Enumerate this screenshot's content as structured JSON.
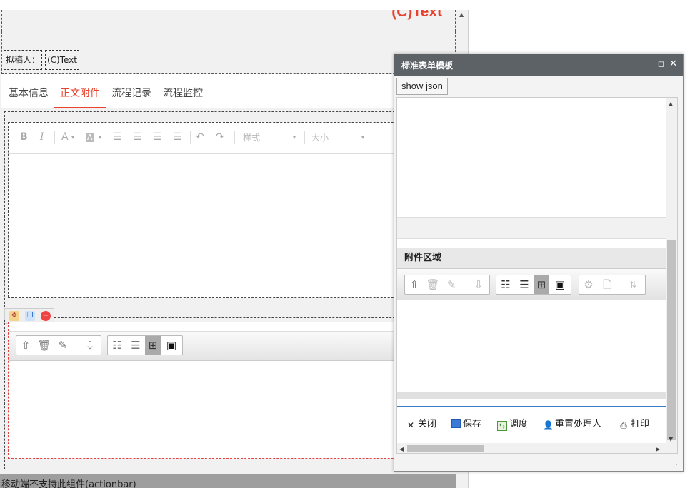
{
  "designer": {
    "title": "(C)Text",
    "drafter_label": "拟稿人：",
    "drafter_value": "(C)Text",
    "tabs": [
      {
        "label": "基本信息"
      },
      {
        "label": "正文附件"
      },
      {
        "label": "流程记录"
      },
      {
        "label": "流程监控"
      }
    ],
    "active_tab": "正文附件",
    "editor": {
      "bold": "B",
      "italic": "I",
      "font_color": "A",
      "bg_color": "A",
      "style_placeholder": "样式",
      "size_placeholder": "大小"
    },
    "actionbar_text": "移动端不支持此组件(actionbar)"
  },
  "dialog": {
    "title": "标准表单模板",
    "show_json_label": "show json",
    "attach_title": "附件区域",
    "actions": [
      {
        "label": "关闭",
        "icon": "close-icon"
      },
      {
        "label": "保存",
        "icon": "save-icon"
      },
      {
        "label": "调度",
        "icon": "dispatch-icon"
      },
      {
        "label": "重置处理人",
        "icon": "reset-handler-icon"
      },
      {
        "label": "打印",
        "icon": "print-icon"
      }
    ]
  },
  "colors": {
    "accent_red": "#e8412e",
    "dialog_header": "#5d6267",
    "divider_blue": "#3d7cc9"
  }
}
